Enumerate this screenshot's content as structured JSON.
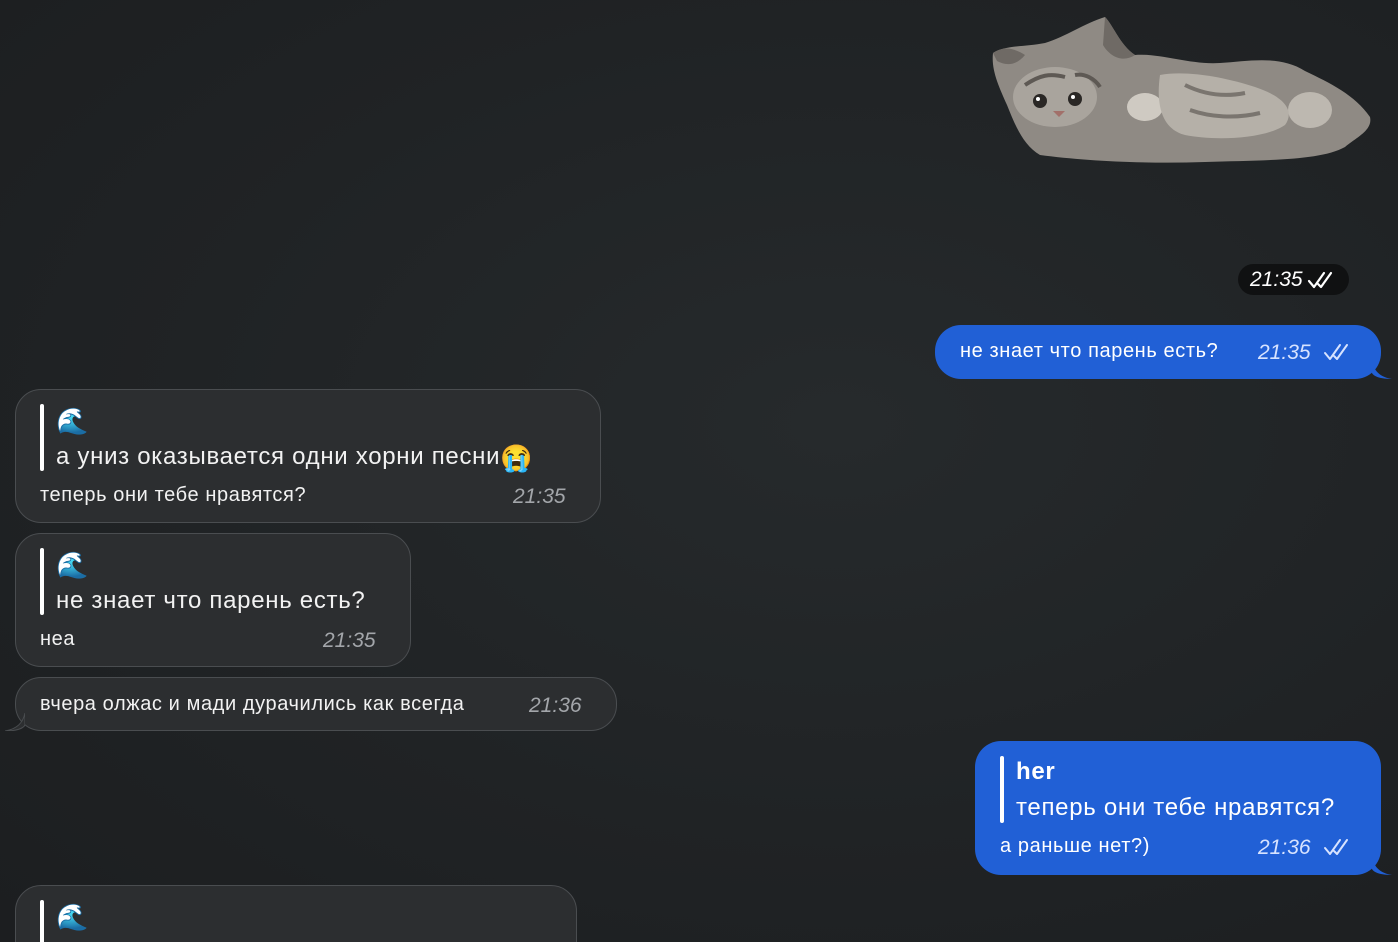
{
  "sticker": {
    "icon": "cat-sticker-icon",
    "time": "21:35"
  },
  "messages": [
    {
      "id": "out1",
      "text": "не знает что парень есть?",
      "time": "21:35"
    },
    {
      "id": "in1",
      "reply_icon": "🌊",
      "reply_text": "а униз оказывается одни хорни песни",
      "reply_emoji": "😭",
      "text": "теперь они тебе нравятся?",
      "time": "21:35"
    },
    {
      "id": "in2",
      "reply_icon": "🌊",
      "reply_text": "не знает что парень есть?",
      "text": "неа",
      "time": "21:35"
    },
    {
      "id": "in3",
      "text": "вчера олжас и мади дурачились как всегда",
      "time": "21:36"
    },
    {
      "id": "out2",
      "reply_author": "her",
      "reply_text": "теперь они тебе нравятся?",
      "text": "а раньше нет?)",
      "time": "21:36"
    },
    {
      "id": "in4",
      "reply_icon": "🌊"
    }
  ],
  "colors": {
    "background": "#1f2123",
    "incoming_bubble": "#2c2e30",
    "outgoing_bubble": "#2160d6"
  }
}
